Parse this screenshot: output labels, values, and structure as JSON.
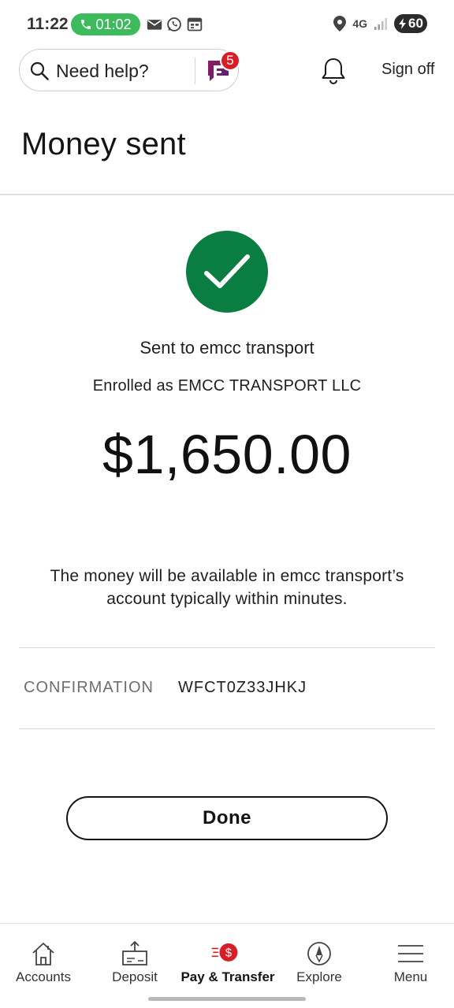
{
  "status_bar": {
    "time": "11:22",
    "call_timer": "01:02",
    "network": "4G",
    "battery": "60",
    "icons": [
      "phone-icon",
      "mail-icon",
      "whatsapp-icon",
      "calendar-icon",
      "location-icon",
      "signal-icon",
      "battery-icon"
    ]
  },
  "header": {
    "search_placeholder": "Need help?",
    "chat_badge_count": "5",
    "sign_off_label": "Sign off"
  },
  "page_title": "Money sent",
  "confirmation_panel": {
    "recipient_line": "Sent to emcc transport",
    "enrolled_line": "Enrolled as EMCC TRANSPORT LLC",
    "amount": "$1,650.00",
    "availability_note": "The money will be available in emcc transport’s account typically within minutes.",
    "confirmation_label": "CONFIRMATION",
    "confirmation_code": "WFCT0Z33JHKJ",
    "done_label": "Done",
    "success_color": "#0a7d43"
  },
  "bottom_nav": {
    "items": [
      {
        "label": "Accounts",
        "icon": "home-icon"
      },
      {
        "label": "Deposit",
        "icon": "deposit-icon"
      },
      {
        "label": "Pay & Transfer",
        "icon": "pay-transfer-icon",
        "active": true
      },
      {
        "label": "Explore",
        "icon": "compass-icon"
      },
      {
        "label": "Menu",
        "icon": "hamburger-menu-icon"
      }
    ],
    "accent_color": "#d71e28"
  }
}
